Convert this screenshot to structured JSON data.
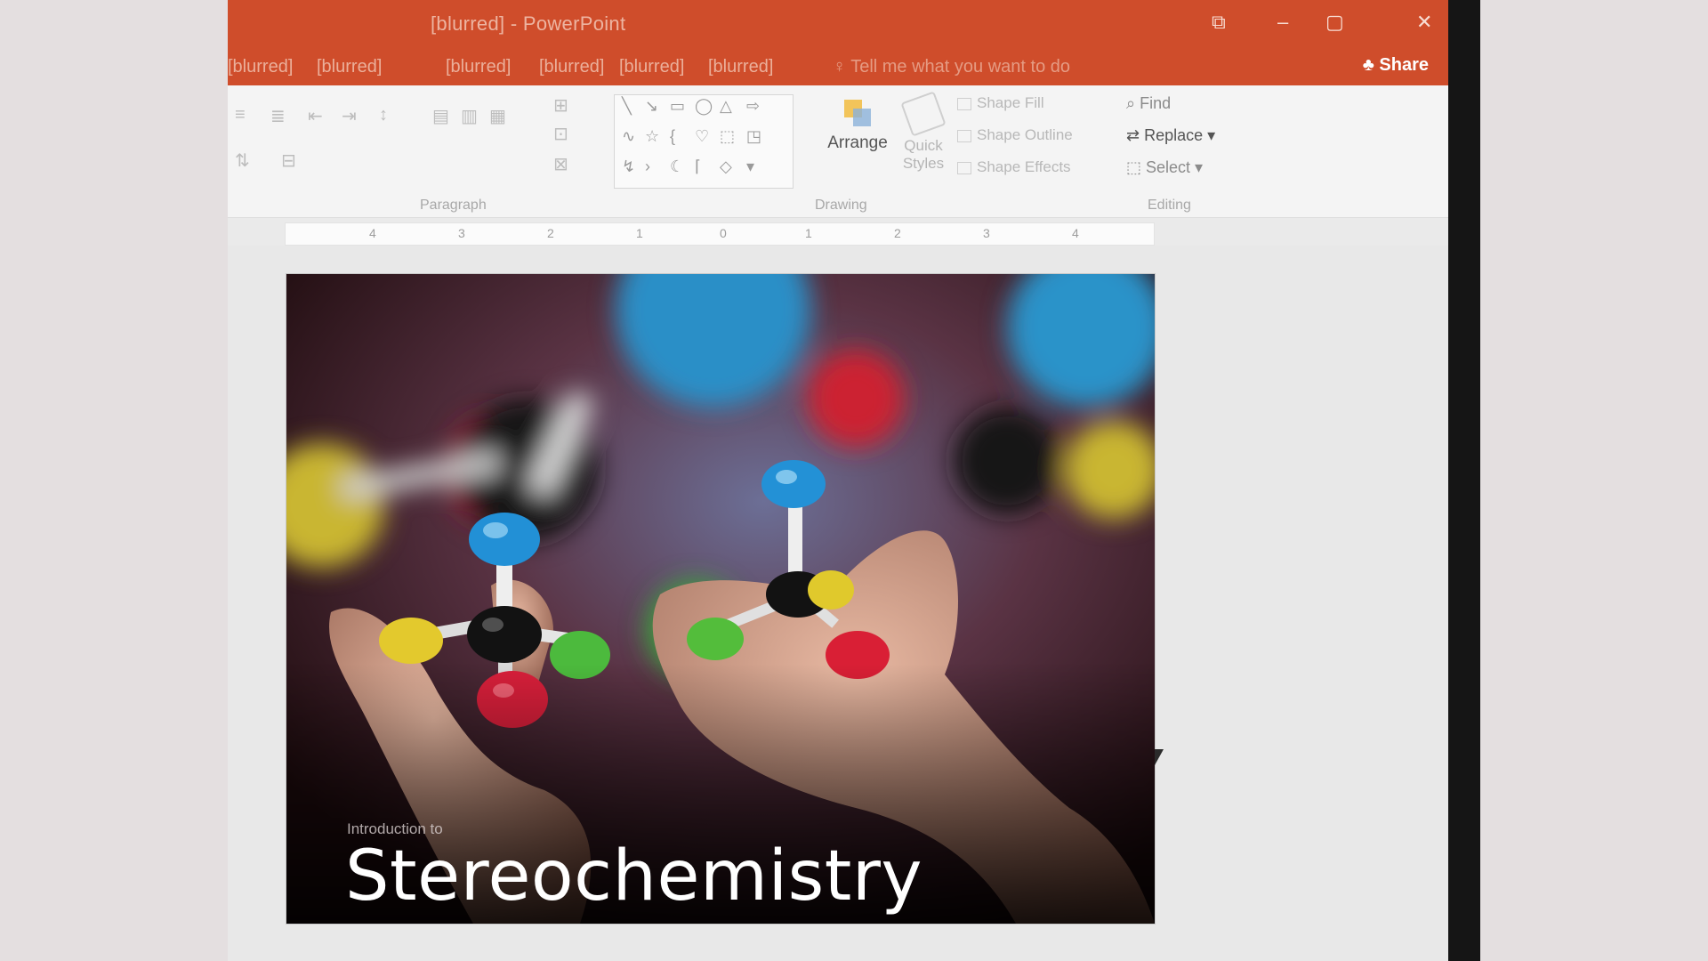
{
  "app": {
    "window_title": "[blurred] - PowerPoint",
    "controls": {
      "restore": "⧉",
      "minimize": "–",
      "maximize": "▢",
      "close": "✕"
    }
  },
  "tabs": [
    "[blurred]",
    "[blurred]",
    "[blurred]",
    "[blurred]",
    "[blurred]",
    "[blurred]"
  ],
  "tell_me": "♀ Tell me what you want to do",
  "share": "♣ Share",
  "ribbon": {
    "groups": {
      "paragraph": "Paragraph",
      "drawing": "Drawing",
      "editing": "Editing"
    },
    "drawing": {
      "arrange": "Arrange",
      "quick_styles": "Quick Styles",
      "shape_fill": "Shape Fill",
      "shape_outline": "Shape Outline",
      "shape_effects": "Shape Effects"
    },
    "editing": {
      "find": "Find",
      "replace": "Replace",
      "select": "Select"
    }
  },
  "ruler": {
    "ticks": [
      "4",
      "3",
      "2",
      "1",
      "0",
      "1",
      "2",
      "3",
      "4"
    ]
  },
  "slide": {
    "kicker": "Introduction to",
    "title": "Stereochemistry"
  }
}
